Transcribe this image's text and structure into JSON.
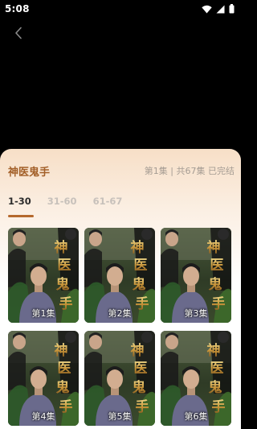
{
  "status_bar": {
    "time": "5:08",
    "icons": [
      "wifi-icon",
      "signal-icon",
      "battery-icon"
    ]
  },
  "back_icon": "chevron-left-icon",
  "sheet": {
    "title": "神医鬼手",
    "episode_status": "第1集 | 共67集 已完结",
    "accent_color": "#b5692d",
    "tabs": [
      {
        "label": "1-30",
        "active": true
      },
      {
        "label": "31-60",
        "active": false
      },
      {
        "label": "61-67",
        "active": false
      }
    ],
    "episodes": [
      {
        "label": "第1集"
      },
      {
        "label": "第2集"
      },
      {
        "label": "第3集"
      },
      {
        "label": "第4集"
      },
      {
        "label": "第5集"
      },
      {
        "label": "第6集"
      }
    ]
  }
}
